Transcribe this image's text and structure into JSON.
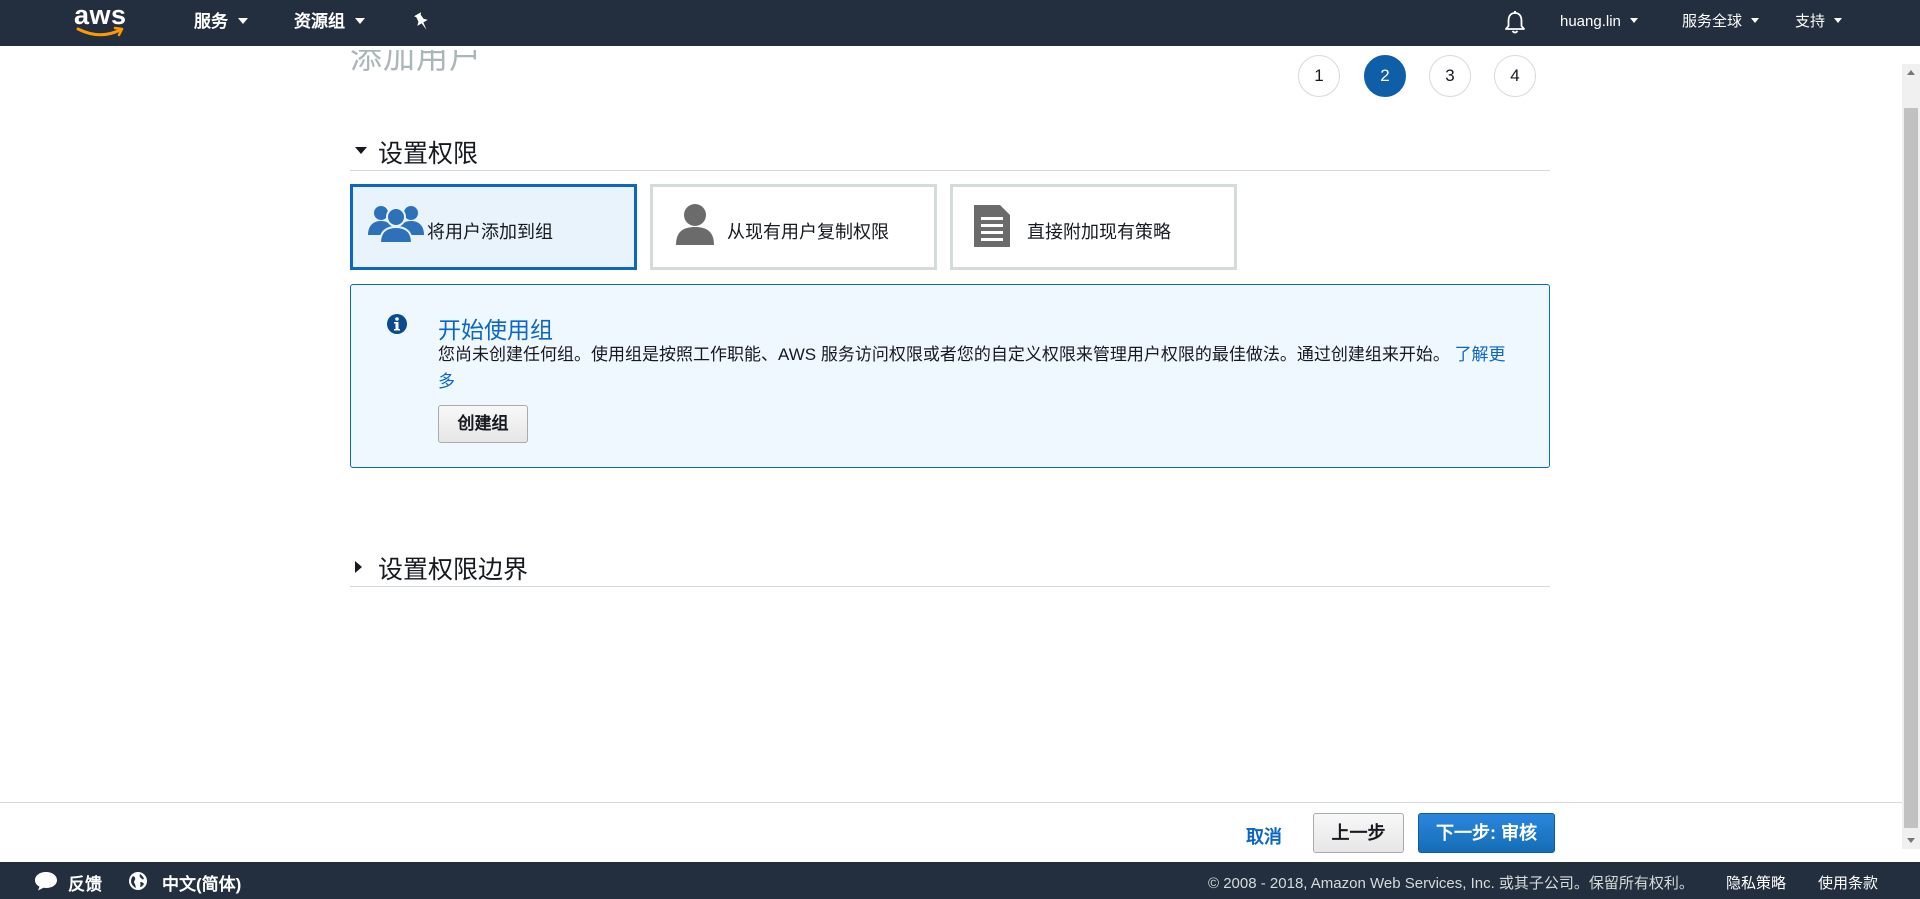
{
  "nav": {
    "logo": "aws",
    "services": "服务",
    "resource_groups": "资源组",
    "user": "huang.lin",
    "region": "服务全球",
    "support": "支持",
    "icons": [
      "pin-icon",
      "bell-icon"
    ]
  },
  "page": {
    "title": "添加用户",
    "steps": [
      "1",
      "2",
      "3",
      "4"
    ],
    "active_step": "2"
  },
  "permissions_section": {
    "title": "设置权限",
    "options": [
      {
        "label": "将用户添加到组",
        "icon": "users-icon",
        "selected": true
      },
      {
        "label": "从现有用户复制权限",
        "icon": "user-icon",
        "selected": false
      },
      {
        "label": "直接附加现有策略",
        "icon": "document-icon",
        "selected": false
      }
    ]
  },
  "info": {
    "title": "开始使用组",
    "text": "您尚未创建任何组。使用组是按照工作职能、AWS 服务访问权限或者您的自定义权限来管理用户权限的最佳做法。通过创建组来开始。",
    "link": "了解更多",
    "button": "创建组"
  },
  "boundary_section": {
    "title": "设置权限边界"
  },
  "actions": {
    "cancel": "取消",
    "previous": "上一步",
    "next": "下一步: 审核"
  },
  "footer": {
    "feedback": "反馈",
    "language": "中文(简体)",
    "copyright": "© 2008 - 2018, Amazon Web Services, Inc. 或其子公司。保留所有权利。",
    "privacy": "隐私策略",
    "terms": "使用条款"
  },
  "colors": {
    "nav_bg": "#232f3e",
    "accent": "#0b66c4",
    "active_step": "#0f5fa8",
    "info_bg": "#f0f8ff"
  }
}
